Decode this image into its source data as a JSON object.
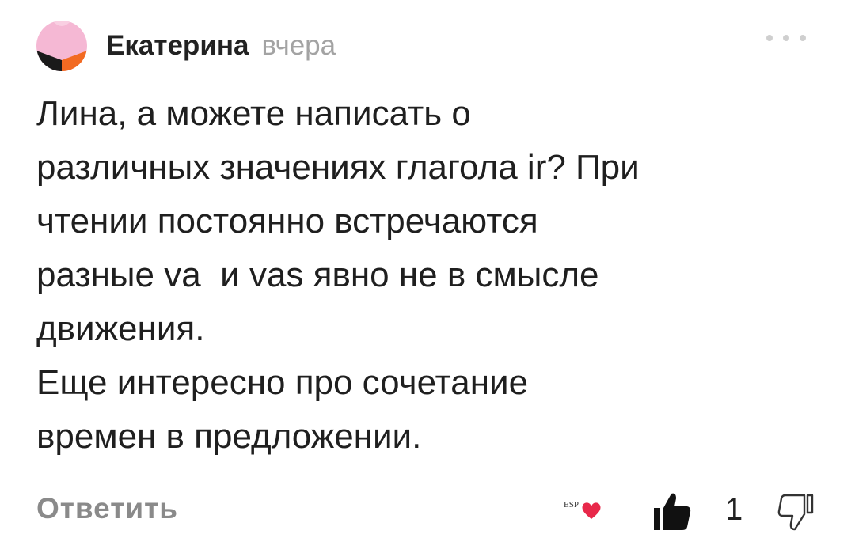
{
  "comment": {
    "author": "Екатерина",
    "timestamp": "вчера",
    "body_lines": [
      "Лина, а можете написать о",
      "различных значениях глагола ir? При",
      "чтении постоянно встречаются",
      "разные va  и vas явно не в смысле",
      "движения.",
      "Еще интересно про сочетание",
      "времен в предложении."
    ],
    "reply_label": "Ответить",
    "author_like_badge": "ESP",
    "like_count": "1"
  },
  "colors": {
    "avatar_top": "#f5b8d4",
    "avatar_left": "#1a1a1a",
    "avatar_right": "#f26a22",
    "heart": "#e8284a",
    "muted_text": "#a3a3a3",
    "reply_text": "#8a8a8a"
  },
  "icons": {
    "avatar": "avatar-image",
    "more": "more-dots-icon",
    "author_like": "heart-icon",
    "like": "thumbs-up-icon",
    "dislike": "thumbs-down-icon"
  }
}
